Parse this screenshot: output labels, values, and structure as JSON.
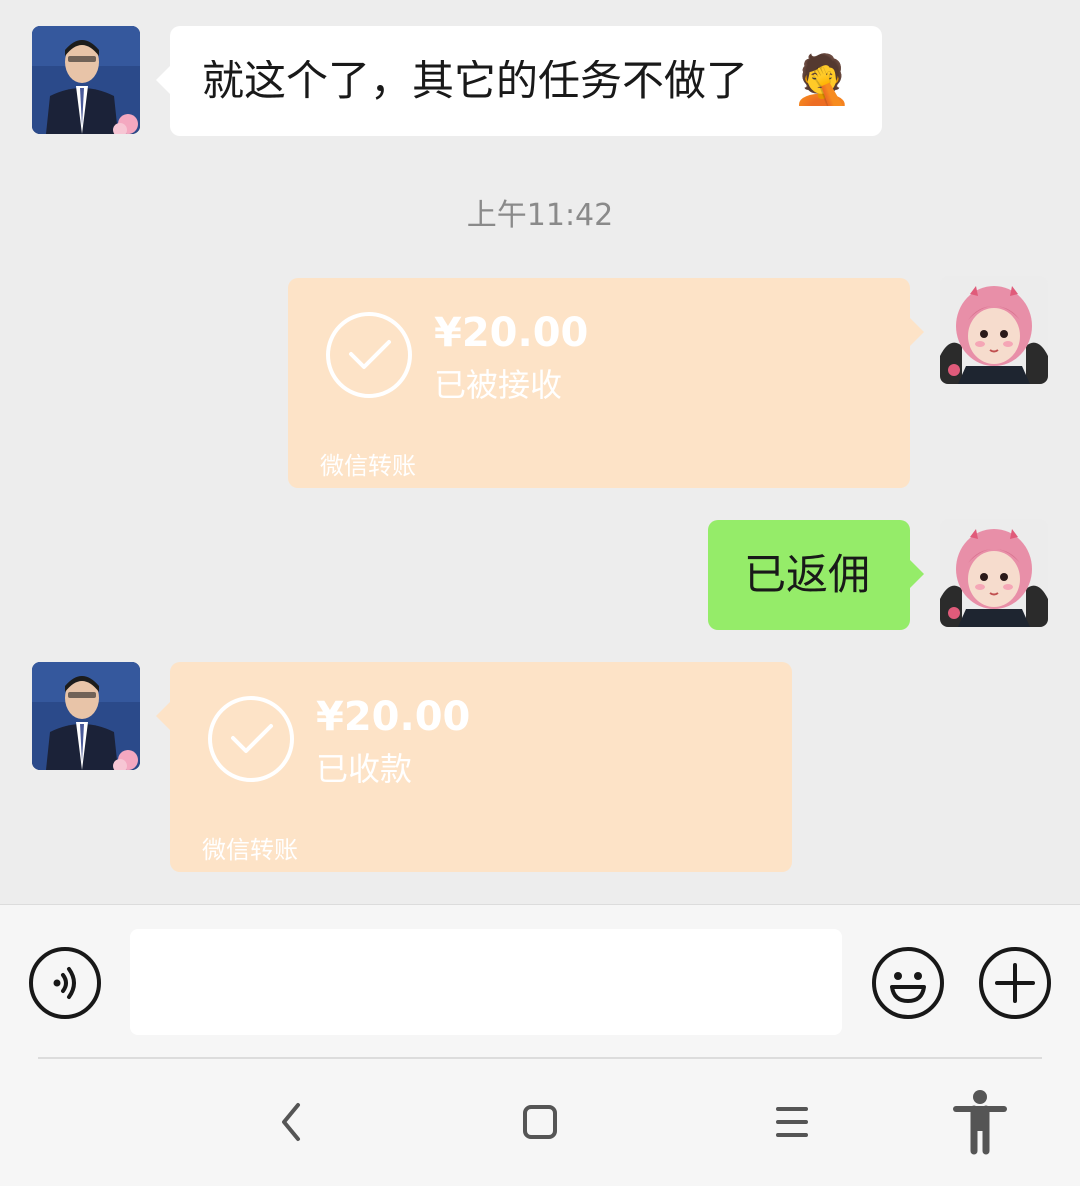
{
  "messages": {
    "first_text": "就这个了，其它的任务不做了",
    "first_emoji": "🤦",
    "timestamp": "上午11:42",
    "transfer_sent": {
      "amount": "¥20.00",
      "status": "已被接收",
      "label": "微信转账"
    },
    "reply_text": "已返佣",
    "transfer_received": {
      "amount": "¥20.00",
      "status": "已收款",
      "label": "微信转账"
    }
  },
  "input": {
    "value": "",
    "placeholder": ""
  },
  "icons": {
    "voice": "voice-icon",
    "emoji": "emoji-icon",
    "plus": "plus-icon",
    "back": "nav-back-icon",
    "home": "nav-home-icon",
    "menu": "nav-menu-icon",
    "accessibility": "accessibility-icon"
  },
  "colors": {
    "background": "#ededed",
    "bubble_white": "#ffffff",
    "bubble_green": "#95ec69",
    "transfer_bg": "#fde3c7",
    "timestamp": "#8a8a8a"
  }
}
